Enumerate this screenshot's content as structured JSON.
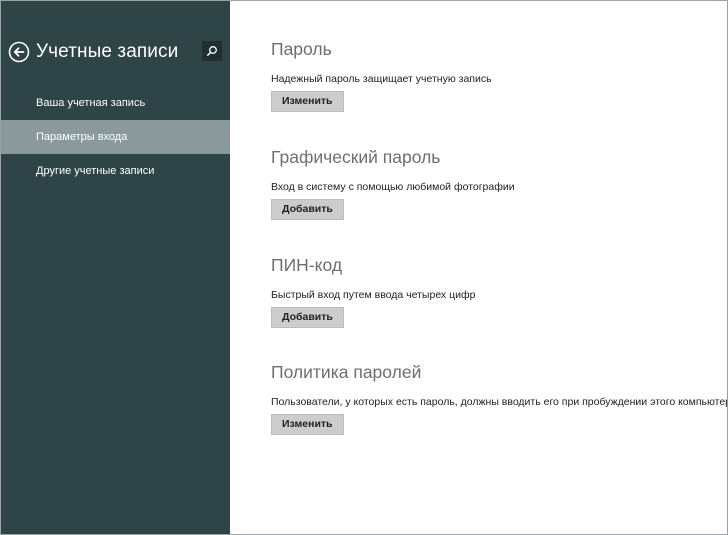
{
  "sidebar": {
    "title": "Учетные записи",
    "back_icon": "back-arrow-circle-icon",
    "search_icon": "search-icon",
    "items": [
      {
        "label": "Ваша учетная запись",
        "active": false
      },
      {
        "label": "Параметры входа",
        "active": true
      },
      {
        "label": "Другие учетные записи",
        "active": false
      }
    ]
  },
  "main": {
    "sections": [
      {
        "title": "Пароль",
        "description": "Надежный пароль защищает учетную запись",
        "button": "Изменить"
      },
      {
        "title": "Графический пароль",
        "description": "Вход в систему с помощью любимой фотографии",
        "button": "Добавить"
      },
      {
        "title": "ПИН-код",
        "description": "Быстрый вход путем ввода четырех цифр",
        "button": "Добавить"
      },
      {
        "title": "Политика паролей",
        "description": "Пользователи, у которых есть пароль, должны вводить его при пробуждении этого компьютера.",
        "button": "Изменить"
      }
    ]
  },
  "colors": {
    "sidebar_bg": "#2e4447",
    "sidebar_active": "#8a9a9c",
    "button_bg": "#cccccc",
    "heading": "#6e6e6e"
  }
}
